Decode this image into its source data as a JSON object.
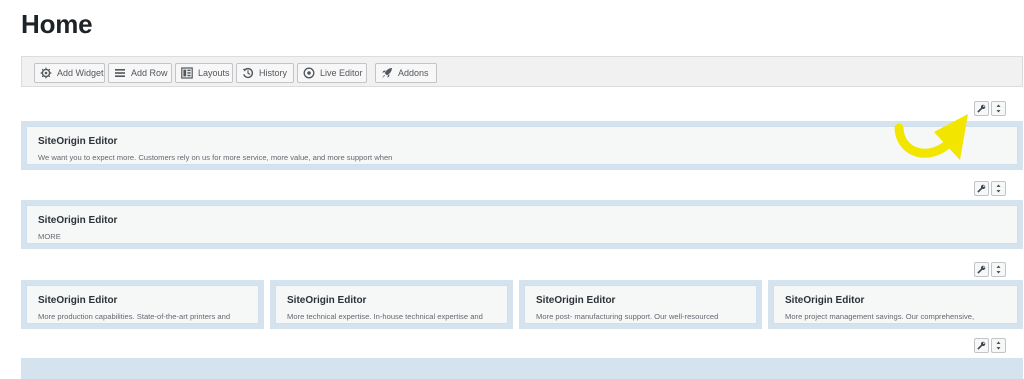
{
  "page": {
    "title": "Home"
  },
  "toolbar": {
    "buttons": [
      {
        "label": "Add Widget",
        "icon": "gear-icon"
      },
      {
        "label": "Add Row",
        "icon": "rows-icon"
      },
      {
        "label": "Layouts",
        "icon": "layouts-icon"
      },
      {
        "label": "History",
        "icon": "history-icon"
      },
      {
        "label": "Live Editor",
        "icon": "eye-icon"
      },
      {
        "label": "Addons",
        "icon": "rocket-icon"
      }
    ]
  },
  "rows": [
    {
      "widgets": [
        {
          "title": "SiteOrigin Editor",
          "desc": "We want you to expect more. Customers rely on us for more service, more value, and more support when"
        }
      ]
    },
    {
      "widgets": [
        {
          "title": "SiteOrigin Editor",
          "desc": "MORE"
        }
      ]
    },
    {
      "widgets": [
        {
          "title": "SiteOrigin Editor",
          "desc": "More production capabilities. State-of-the-art printers and"
        },
        {
          "title": "SiteOrigin Editor",
          "desc": "More technical expertise. In-house technical expertise and"
        },
        {
          "title": "SiteOrigin Editor",
          "desc": "More post- manufacturing support. Our well-resourced"
        },
        {
          "title": "SiteOrigin Editor",
          "desc": "More project management savings. Our comprehensive,"
        }
      ]
    },
    {
      "widgets": []
    }
  ],
  "row_tools": {
    "edit_icon": "wrench-icon",
    "move_icon": "move-icon"
  },
  "colors": {
    "row_bg": "#d4e3ee",
    "annotation_arrow": "#f2e600"
  }
}
